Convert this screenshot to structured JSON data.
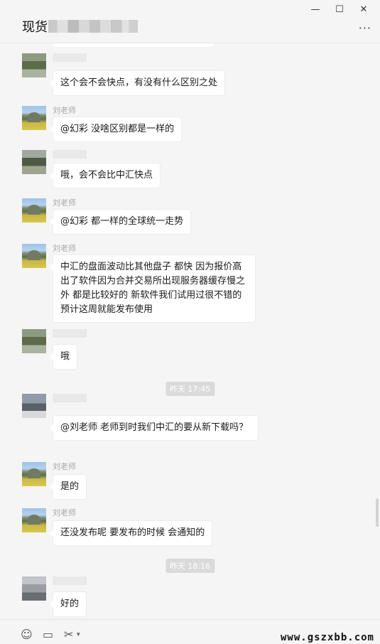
{
  "window": {
    "title": "现货",
    "controls": {
      "minimize": "—",
      "maximize": "☐",
      "close": "✕"
    },
    "more": "···"
  },
  "messages": [
    {
      "sender": "",
      "text": "这个会不会快点，有没有什么区别之处"
    },
    {
      "sender": "刘老师",
      "text": "@幻彩 没啥区别都是一样的"
    },
    {
      "sender": "",
      "text": "哦，会不会比中汇快点"
    },
    {
      "sender": "刘老师",
      "text": "@幻彩 都一样的全球统一走势"
    },
    {
      "sender": "刘老师",
      "text": "中汇的盘面波动比其他盘子 都快 因为报价高  出了软件因为合并交易所出现服务器缓存慢之外 都是比较好的 新软件我们试用过很不错的 预计这周就能发布使用"
    },
    {
      "sender": "",
      "text": "哦"
    },
    {
      "timestamp": "昨天 17:45"
    },
    {
      "sender": "",
      "text": "@刘老师 老师到时我们中汇的要从新下载吗？"
    },
    {
      "sender": "刘老师",
      "text": "是的"
    },
    {
      "sender": "刘老师",
      "text": "还没发布呢 要发布的时候 会通知的"
    },
    {
      "timestamp": "昨天 18:16"
    },
    {
      "sender": "",
      "text": "好的"
    }
  ],
  "toolbar": {
    "emoji": "☺",
    "folder": "▭",
    "scissors": "✂",
    "watermark": "www.gszxbb.com"
  },
  "icons": {
    "emoji": "smiley-icon",
    "folder": "folder-icon",
    "scissors": "scissors-icon",
    "video": "video-call-icon"
  }
}
